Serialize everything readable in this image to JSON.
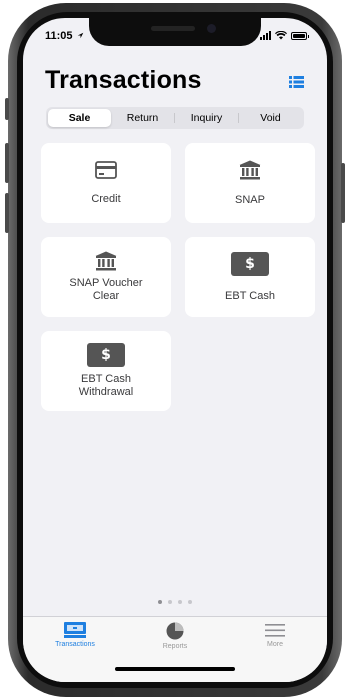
{
  "status_bar": {
    "time": "11:05"
  },
  "header": {
    "title": "Transactions"
  },
  "segments": [
    {
      "label": "Sale",
      "active": true
    },
    {
      "label": "Return",
      "active": false
    },
    {
      "label": "Inquiry",
      "active": false
    },
    {
      "label": "Void",
      "active": false
    }
  ],
  "tiles": [
    {
      "label": "Credit",
      "icon": "credit-card-icon"
    },
    {
      "label": "SNAP",
      "icon": "bank-icon"
    },
    {
      "label": "SNAP Voucher\nClear",
      "icon": "bank-icon"
    },
    {
      "label": "EBT Cash",
      "icon": "dollar-icon",
      "icon_text": "$"
    },
    {
      "label": "EBT Cash\nWithdrawal",
      "icon": "dollar-icon",
      "icon_text": "$"
    }
  ],
  "page_dots": {
    "count": 4,
    "active_index": 0
  },
  "tabbar": {
    "items": [
      {
        "label": "Transactions",
        "icon": "pos-terminal-icon",
        "active": true
      },
      {
        "label": "Reports",
        "icon": "pie-chart-icon",
        "active": false
      },
      {
        "label": "More",
        "icon": "hamburger-menu-icon",
        "active": false
      }
    ]
  },
  "colors": {
    "accent": "#1E7FE0",
    "background": "#F1F1F5",
    "icon_dark": "#555555"
  }
}
